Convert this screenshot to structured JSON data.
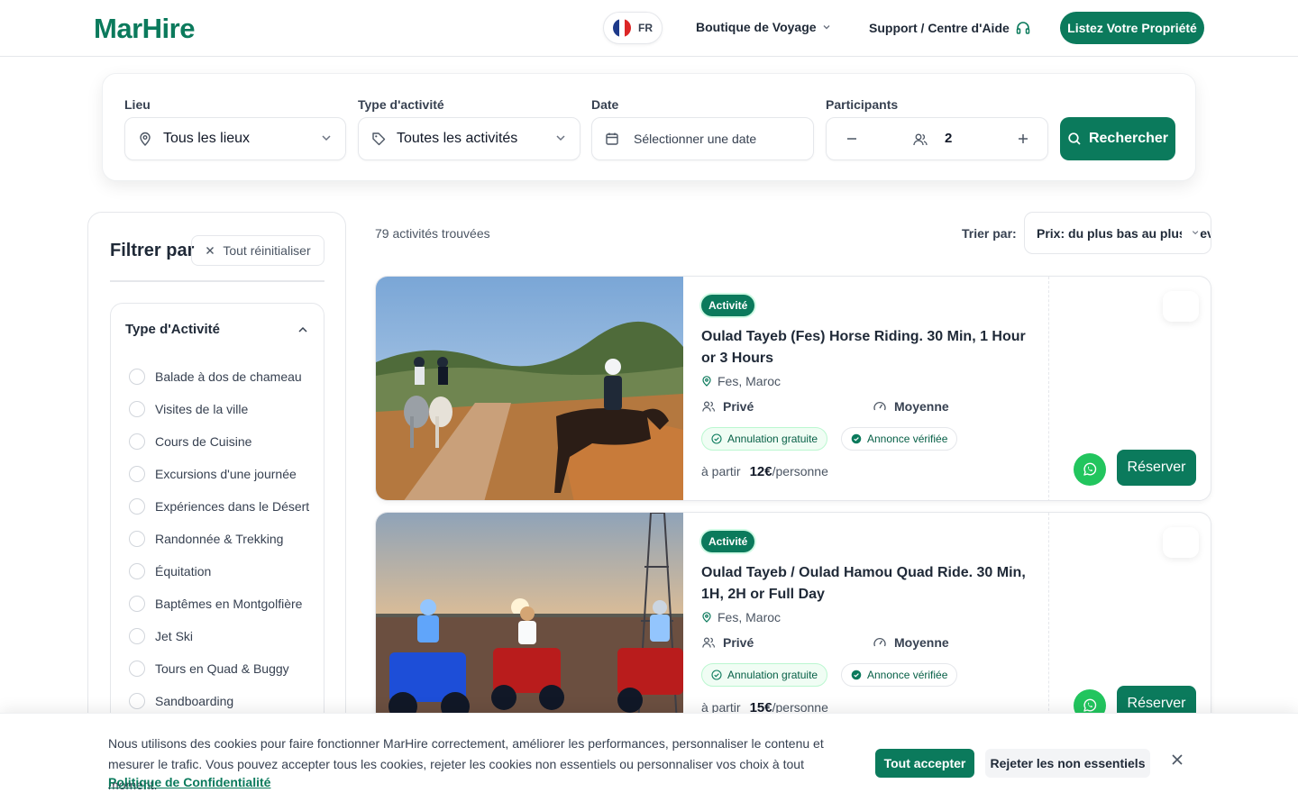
{
  "brand": {
    "name": "MarHire",
    "color": "#0b7a5c"
  },
  "header": {
    "lang": "FR",
    "nav_shop": "Boutique de Voyage",
    "nav_support": "Support / Centre d'Aide",
    "cta": "Listez Votre Propriété"
  },
  "search": {
    "location": {
      "label": "Lieu",
      "value": "Tous les lieux"
    },
    "activity": {
      "label": "Type d'activité",
      "value": "Toutes les activités"
    },
    "date": {
      "label": "Date",
      "placeholder": "Sélectionner une date"
    },
    "participants": {
      "label": "Participants",
      "value": "2"
    },
    "button": "Rechercher"
  },
  "filters": {
    "title": "Filtrer par",
    "reset": "Tout réinitialiser",
    "type_section": {
      "title": "Type d'Activité",
      "options": [
        "Balade à dos de chameau",
        "Visites de la ville",
        "Cours de Cuisine",
        "Excursions d'une journée",
        "Expériences dans le Désert",
        "Randonnée & Trekking",
        "Équitation",
        "Baptêmes en Montgolfière",
        "Jet Ski",
        "Tours en Quad & Buggy",
        "Sandboarding"
      ]
    }
  },
  "results": {
    "count": "79 activités trouvées",
    "sort_label": "Trier par:",
    "sort_value": "Prix: du plus bas au plus élevé",
    "cards": [
      {
        "badge": "Activité",
        "title": "Oulad Tayeb (Fes) Horse Riding. 30 Min, 1 Hour or 3 Hours",
        "location": "Fes, Maroc",
        "privacy": "Privé",
        "difficulty": "Moyenne",
        "chip1": "Annulation gratuite",
        "chip2": "Annonce vérifiée",
        "price_prefix": "à partir",
        "price": "12€",
        "price_unit": "/personne",
        "reserve": "Réserver"
      },
      {
        "badge": "Activité",
        "title": "Oulad Tayeb / Oulad Hamou Quad Ride. 30 Min, 1H, 2H or Full Day",
        "location": "Fes, Maroc",
        "privacy": "Privé",
        "difficulty": "Moyenne",
        "chip1": "Annulation gratuite",
        "chip2": "Annonce vérifiée",
        "price_prefix": "à partir",
        "price": "15€",
        "price_unit": "/personne",
        "reserve": "Réserver"
      }
    ]
  },
  "cookie": {
    "text": "Nous utilisons des cookies pour faire fonctionner MarHire correctement, améliorer les performances, personnaliser le contenu et mesurer le trafic. Vous pouvez accepter tous les cookies, rejeter les cookies non essentiels ou personnaliser vos choix à tout moment.",
    "link": "Politique de Confidentialité",
    "accept": "Tout accepter",
    "reject": "Rejeter les non essentiels"
  }
}
